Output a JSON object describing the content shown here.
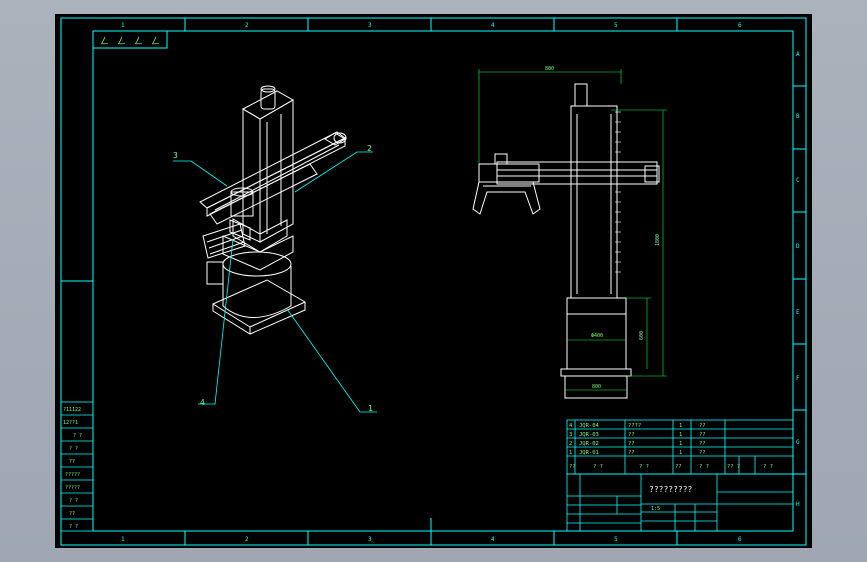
{
  "colors": {
    "sheet": "#000000",
    "frame": "#00ffff",
    "model": "#ffffff",
    "dims": "#00ff3c"
  },
  "border_columns": [
    "1",
    "2",
    "3",
    "4",
    "5",
    "6"
  ],
  "border_rows": [
    "A",
    "B",
    "C",
    "D",
    "E",
    "F",
    "G",
    "H"
  ],
  "corner_stamp": [
    "ㄥ",
    "ㄥ",
    "ㄥ",
    "ㄥ"
  ],
  "callouts": {
    "c1": "1",
    "c2": "2",
    "c3": "3",
    "c4": "4"
  },
  "dims": {
    "top_width": "800",
    "total_height": "1800",
    "base_height": "600",
    "base_width": "800",
    "base_dia": "Ф400"
  },
  "bom": [
    {
      "no": "4",
      "code": "JQR-04",
      "name": "????",
      "qty": "1",
      "mat": "??"
    },
    {
      "no": "3",
      "code": "JQR-03",
      "name": "??",
      "qty": "1",
      "mat": "??"
    },
    {
      "no": "2",
      "code": "JQR-02",
      "name": "??",
      "qty": "1",
      "mat": "??"
    },
    {
      "no": "1",
      "code": "JQR-01",
      "name": "??",
      "qty": "1",
      "mat": "??"
    }
  ],
  "bom_header": [
    "??",
    "? ?",
    "? ?",
    "??",
    "? ?",
    "?? ?",
    "? ?"
  ],
  "title_block": {
    "drawing_title": "?????????",
    "scale": "1:5"
  },
  "left_strip": [
    "?11122",
    "12??1",
    "? ?",
    "? ?",
    "??",
    "?????",
    "?????",
    "? ?",
    "??",
    "? ?"
  ]
}
